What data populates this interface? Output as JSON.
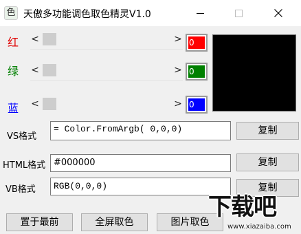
{
  "window": {
    "title": "天傲多功能调色取色精灵V1.0",
    "icon_glyph": "色"
  },
  "channels": [
    {
      "label": "红",
      "label_color": "#e00000",
      "value": "0",
      "swatch_color": "#ff0000",
      "slider_level": 0
    },
    {
      "label": "绿",
      "label_color": "#008000",
      "value": "0",
      "swatch_color": "#008000",
      "slider_level": 0
    },
    {
      "label": "蓝",
      "label_color": "#0000ff",
      "value": "0",
      "swatch_color": "#0000ff",
      "slider_level": 0
    }
  ],
  "preview": {
    "color": "#000000"
  },
  "outputs": {
    "vs": {
      "label": "VS格式",
      "value": " = Color.FromArgb( 0,0,0)",
      "copy_label": "复制"
    },
    "html": {
      "label": "HTML格式",
      "value": "#000000",
      "copy_label": "复制"
    },
    "vb": {
      "label": "VB格式",
      "value": "RGB(0,0,0)",
      "copy_label": "复制"
    }
  },
  "bottom_buttons": {
    "top_most": "置于最前",
    "screen_pick": "全屏取色",
    "image_pick": "图片取色"
  },
  "watermark": {
    "text": "下载吧",
    "url": "www.xiazaiba.com"
  }
}
